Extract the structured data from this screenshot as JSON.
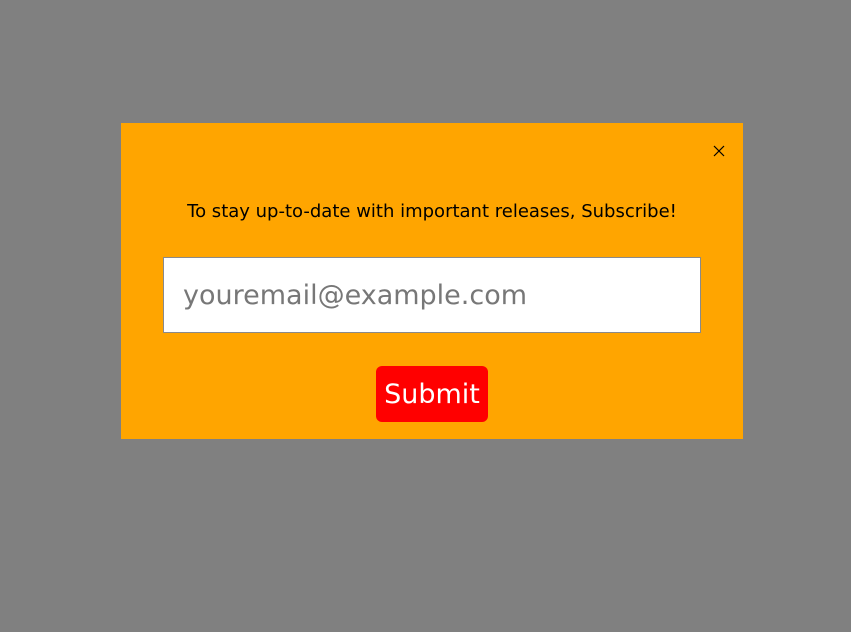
{
  "overlay": {
    "background_color": "#808080"
  },
  "modal": {
    "background_color": "#FFA500",
    "close_icon": "close-icon",
    "message": "To stay up-to-date with important releases, Subscribe!",
    "email_input": {
      "placeholder": "youremail@example.com",
      "value": ""
    },
    "submit_label": "Submit",
    "submit_color": "#FF0000"
  }
}
